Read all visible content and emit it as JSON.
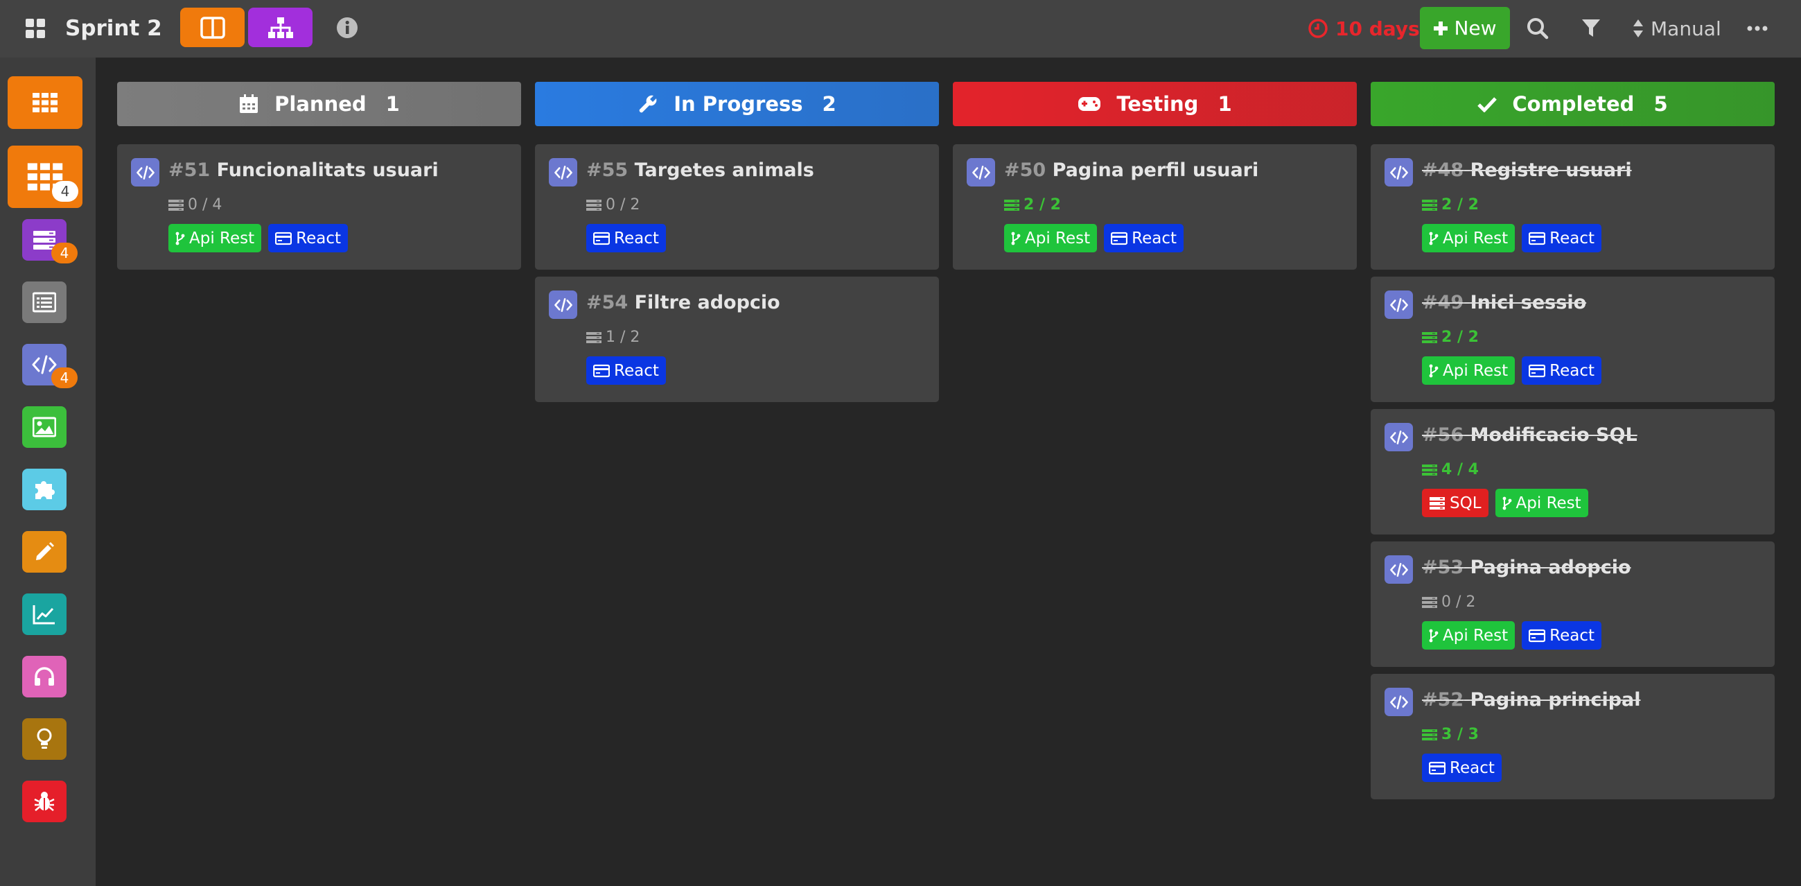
{
  "header": {
    "title": "Sprint 2",
    "deadline": "10 days",
    "new_label": "New",
    "sort_label": "Manual"
  },
  "sidebar": {
    "items": [
      {
        "name": "all",
        "badge": ""
      },
      {
        "name": "grid",
        "badge": "4"
      },
      {
        "name": "database",
        "badge": "4"
      },
      {
        "name": "list",
        "badge": ""
      },
      {
        "name": "code",
        "badge": "4"
      },
      {
        "name": "image",
        "badge": ""
      },
      {
        "name": "puzzle",
        "badge": ""
      },
      {
        "name": "pencil",
        "badge": ""
      },
      {
        "name": "chart",
        "badge": ""
      },
      {
        "name": "headphones",
        "badge": ""
      },
      {
        "name": "bulb",
        "badge": ""
      },
      {
        "name": "bug",
        "badge": ""
      }
    ]
  },
  "columns": [
    {
      "title": "Planned",
      "count": "1",
      "icon": "calendar-icon",
      "color": "#7d7d7d",
      "cards": [
        {
          "num": "#51",
          "title": "Funcionalitats usuari",
          "progress": "0 / 4",
          "done": false,
          "tags": [
            "Api Rest",
            "React"
          ]
        }
      ]
    },
    {
      "title": "In Progress",
      "count": "2",
      "icon": "wrench-icon",
      "color": "#2a7be0",
      "cards": [
        {
          "num": "#55",
          "title": "Targetes animals",
          "progress": "0 / 2",
          "done": false,
          "tags": [
            "React"
          ]
        },
        {
          "num": "#54",
          "title": "Filtre adopcio",
          "progress": "1 / 2",
          "done": false,
          "tags": [
            "React"
          ]
        }
      ]
    },
    {
      "title": "Testing",
      "count": "1",
      "icon": "gamepad-icon",
      "color": "#e3232b",
      "cards": [
        {
          "num": "#50",
          "title": "Pagina perfil usuari",
          "progress": "2 / 2",
          "done": false,
          "tags": [
            "Api Rest",
            "React"
          ]
        }
      ]
    },
    {
      "title": "Completed",
      "count": "5",
      "icon": "check-icon",
      "color": "#39a62b",
      "cards": [
        {
          "num": "#48",
          "title": "Registre usuari",
          "progress": "2 / 2",
          "done": true,
          "tags": [
            "Api Rest",
            "React"
          ]
        },
        {
          "num": "#49",
          "title": "Inici sessio",
          "progress": "2 / 2",
          "done": true,
          "tags": [
            "Api Rest",
            "React"
          ]
        },
        {
          "num": "#56",
          "title": "Modificacio SQL",
          "progress": "4 / 4",
          "done": true,
          "tags": [
            "SQL",
            "Api Rest"
          ]
        },
        {
          "num": "#53",
          "title": "Pagina adopcio",
          "progress": "0 / 2",
          "done": true,
          "tags": [
            "Api Rest",
            "React"
          ]
        },
        {
          "num": "#52",
          "title": "Pagina principal",
          "progress": "3 / 3",
          "done": true,
          "tags": [
            "React"
          ]
        }
      ]
    }
  ]
}
